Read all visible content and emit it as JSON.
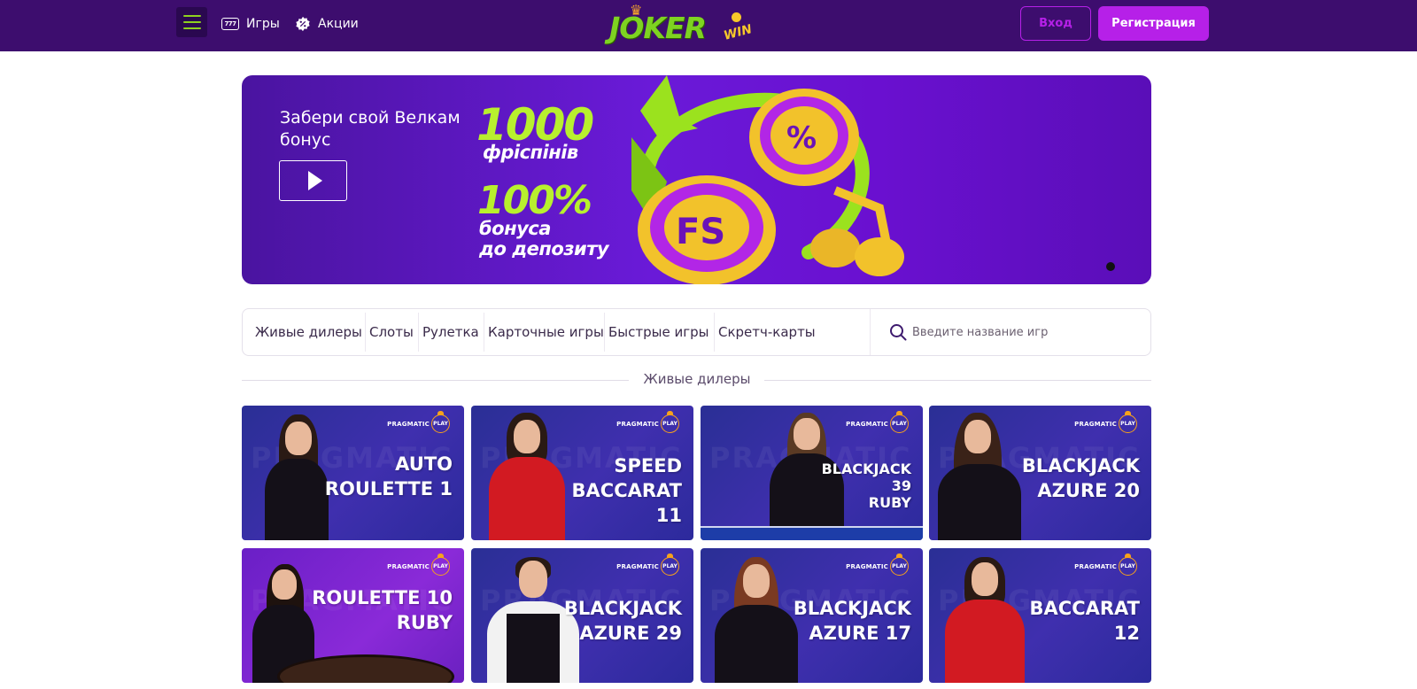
{
  "header": {
    "games_label": "Игры",
    "promo_label": "Акции",
    "games_icon_text": "777",
    "logo_text": "JOKER",
    "logo_sub": "WIN",
    "login_label": "Вход",
    "register_label": "Регистрация",
    "colors": {
      "bg": "#3d0d6e",
      "accent": "#b620e8",
      "logo_green": "#7ed321"
    }
  },
  "banner": {
    "title": "Забери свой Велкам бонус",
    "freespins_count": "1000",
    "freespins_label": "фріспінів",
    "bonus_percent": "100%",
    "bonus_label_1": "бонуса",
    "bonus_label_2": "до депозиту",
    "chip_percent_text": "%",
    "chip_fs_text": "FS"
  },
  "categories": {
    "items": [
      "Живые дилеры",
      "Слоты",
      "Рулетка",
      "Карточные игры",
      "Быстрые игры",
      "Скретч-карты"
    ],
    "search_placeholder": "Введите название игр"
  },
  "section": {
    "title": "Живые дилеры"
  },
  "games": [
    {
      "title_lines": [
        "AUTO",
        "ROULETTE 1"
      ],
      "provider": "PRAGMATIC",
      "badge": "PLAY"
    },
    {
      "title_lines": [
        "SPEED",
        "BACCARAT",
        "11"
      ],
      "provider": "PRAGMATIC",
      "badge": "PLAY"
    },
    {
      "title_lines": [
        "BLACKJACK",
        "39",
        "RUBY"
      ],
      "provider": "PRAGMATIC",
      "badge": "PLAY"
    },
    {
      "title_lines": [
        "BLACKJACK",
        "AZURE 20"
      ],
      "provider": "PRAGMATIC",
      "badge": "PLAY"
    },
    {
      "title_lines": [
        "ROULETTE 10",
        "RUBY"
      ],
      "provider": "PRAGMATIC",
      "badge": "PLAY"
    },
    {
      "title_lines": [
        "BLACKJACK",
        "AZURE 29"
      ],
      "provider": "PRAGMATIC",
      "badge": "PLAY"
    },
    {
      "title_lines": [
        "BLACKJACK",
        "AZURE 17"
      ],
      "provider": "PRAGMATIC",
      "badge": "PLAY"
    },
    {
      "title_lines": [
        "BACCARAT",
        "12"
      ],
      "provider": "PRAGMATIC",
      "badge": "PLAY"
    }
  ]
}
